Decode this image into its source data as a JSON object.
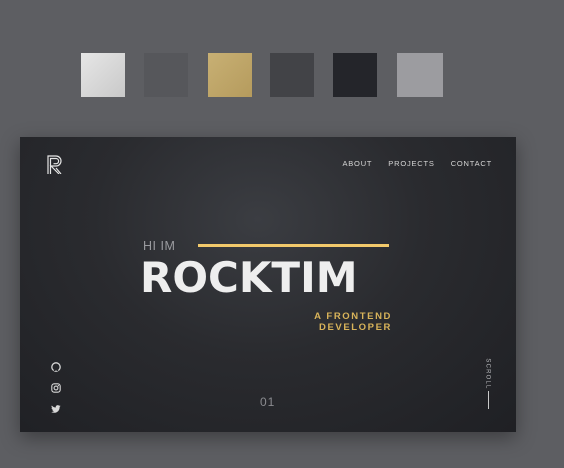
{
  "palette": [
    {
      "name": "light-gray",
      "color": "#dcdcdc"
    },
    {
      "name": "mid-gray",
      "color": "#56575b"
    },
    {
      "name": "gold",
      "color": "#bfa76a"
    },
    {
      "name": "charcoal",
      "color": "#424347"
    },
    {
      "name": "black",
      "color": "#24252a"
    },
    {
      "name": "silver",
      "color": "#9c9ca0"
    }
  ],
  "header": {
    "logo_letter": "R",
    "nav": [
      "ABOUT",
      "PROJECTS",
      "CONTACT"
    ]
  },
  "hero": {
    "greeting": "HI IM",
    "name": "ROCKTIM",
    "role_line1": "A FRONTEND",
    "role_line2": "DEVELOPER",
    "accent_color": "#f2c96b"
  },
  "social": [
    "github-icon",
    "instagram-icon",
    "twitter-icon"
  ],
  "page_number": "01",
  "scroll_label": "SCROLL"
}
